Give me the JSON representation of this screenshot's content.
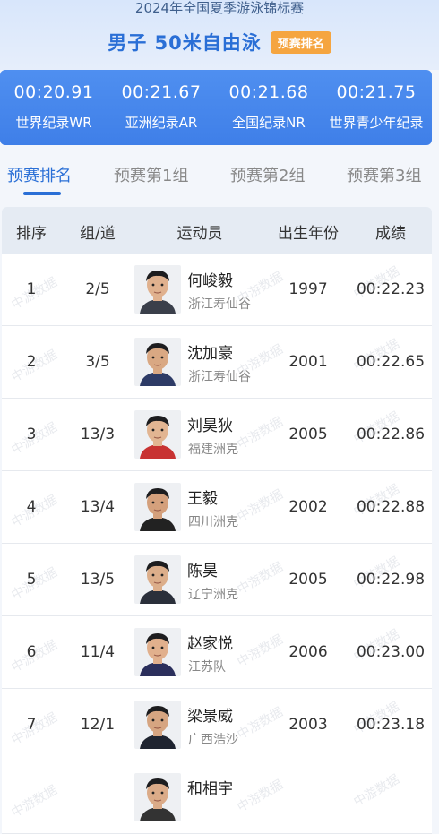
{
  "header": {
    "subtitle": "2024年全国夏季游泳锦标赛",
    "title": "男子 50米自由泳",
    "tag": "预赛排名"
  },
  "records": [
    {
      "time": "00:20.91",
      "label": "世界纪录WR"
    },
    {
      "time": "00:21.67",
      "label": "亚洲纪录AR"
    },
    {
      "time": "00:21.68",
      "label": "全国纪录NR"
    },
    {
      "time": "00:21.75",
      "label": "世界青少年纪录"
    }
  ],
  "tabs": [
    "预赛排名",
    "预赛第1组",
    "预赛第2组",
    "预赛第3组"
  ],
  "table": {
    "columns": [
      "排序",
      "组/道",
      "运动员",
      "出生年份",
      "成绩"
    ],
    "rows": [
      {
        "rank": "1",
        "lane": "2/5",
        "name": "何峻毅",
        "team": "浙江寿仙谷",
        "year": "1997",
        "result": "00:22.23"
      },
      {
        "rank": "2",
        "lane": "3/5",
        "name": "沈加豪",
        "team": "浙江寿仙谷",
        "year": "2001",
        "result": "00:22.65"
      },
      {
        "rank": "3",
        "lane": "13/3",
        "name": "刘昊狄",
        "team": "福建洲克",
        "year": "2005",
        "result": "00:22.86"
      },
      {
        "rank": "4",
        "lane": "13/4",
        "name": "王毅",
        "team": "四川洲克",
        "year": "2002",
        "result": "00:22.88"
      },
      {
        "rank": "5",
        "lane": "13/5",
        "name": "陈昊",
        "team": "辽宁洲克",
        "year": "2005",
        "result": "00:22.98"
      },
      {
        "rank": "6",
        "lane": "11/4",
        "name": "赵家悦",
        "team": "江苏队",
        "year": "2006",
        "result": "00:23.00"
      },
      {
        "rank": "7",
        "lane": "12/1",
        "name": "梁景威",
        "team": "广西浩沙",
        "year": "2003",
        "result": "00:23.18"
      },
      {
        "rank": "",
        "lane": "",
        "name": "和相宇",
        "team": "",
        "year": "",
        "result": ""
      }
    ]
  },
  "watermark": "中游数据",
  "colors": {
    "accent": "#2a6fd6",
    "tag": "#f5a540",
    "banner": "#4a8af0"
  },
  "icons": {
    "avatar": "athlete-photo"
  }
}
